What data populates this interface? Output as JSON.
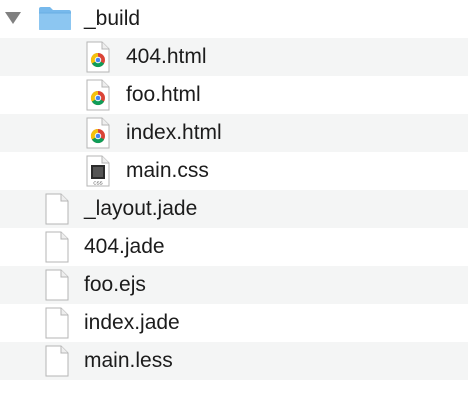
{
  "tree": {
    "folder": {
      "name": "_build",
      "expanded": true
    },
    "children": [
      {
        "name": "404.html",
        "icon": "chrome-html-file-icon"
      },
      {
        "name": "foo.html",
        "icon": "chrome-html-file-icon"
      },
      {
        "name": "index.html",
        "icon": "chrome-html-file-icon"
      },
      {
        "name": "main.css",
        "icon": "css-file-icon"
      }
    ],
    "files": [
      {
        "name": "_layout.jade",
        "icon": "document-icon"
      },
      {
        "name": "404.jade",
        "icon": "document-icon"
      },
      {
        "name": "foo.ejs",
        "icon": "document-icon"
      },
      {
        "name": "index.jade",
        "icon": "document-icon"
      },
      {
        "name": "main.less",
        "icon": "document-icon"
      }
    ]
  },
  "css_badge": "CSS",
  "colors": {
    "row_alt": "#f4f5f5",
    "folder": "#6fb3e8",
    "text": "#1c1c1c"
  }
}
